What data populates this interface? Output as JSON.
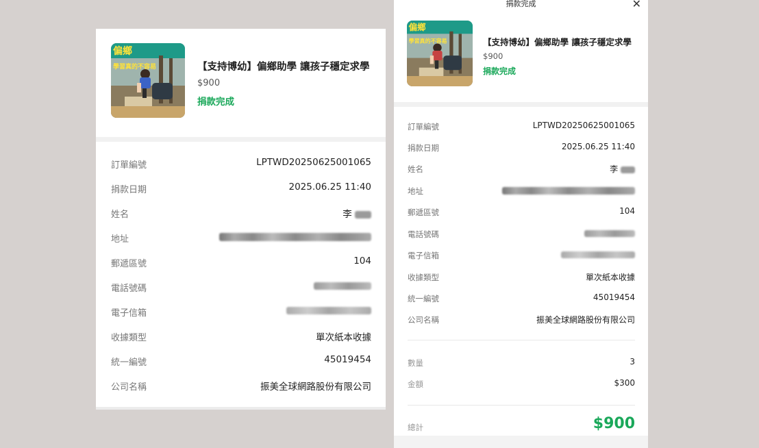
{
  "campaign": {
    "title": "【支持博幼】偏鄉助學 讓孩子穩定求學",
    "price": "$900",
    "status": "捐款完成",
    "thumb_text_top": "偏鄉",
    "thumb_text_bottom": "學習真的不容易"
  },
  "modal": {
    "title": "捐款完成"
  },
  "details": [
    {
      "label": "訂單編號",
      "value": "LPTWD20250625001065"
    },
    {
      "label": "捐款日期",
      "value": "2025.06.25 11:40"
    },
    {
      "label": "姓名",
      "value": "李"
    },
    {
      "label": "地址",
      "value": ""
    },
    {
      "label": "郵遞區號",
      "value": "104"
    },
    {
      "label": "電話號碼",
      "value": ""
    },
    {
      "label": "電子信箱",
      "value": ""
    },
    {
      "label": "收據類型",
      "value": "單次紙本收據"
    },
    {
      "label": "統一編號",
      "value": "45019454"
    },
    {
      "label": "公司名稱",
      "value": "振美全球網路股份有限公司"
    }
  ],
  "summary": {
    "quantity_label": "數量",
    "quantity_value": "3",
    "amount_label": "金額",
    "amount_value": "$300",
    "total_label": "總計",
    "total_value": "$900"
  },
  "colors": {
    "accent_green": "#1aa85a",
    "background": "#d6d1cf",
    "panel": "#ffffff"
  },
  "icons": {
    "close": "close-icon"
  }
}
